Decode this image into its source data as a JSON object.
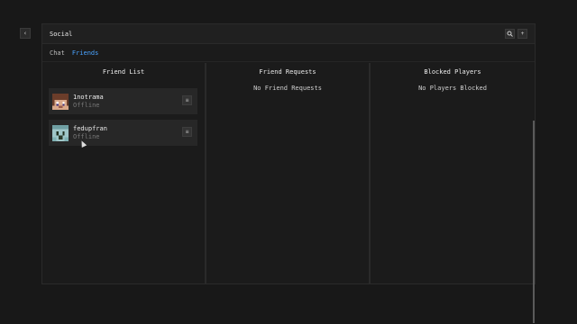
{
  "window": {
    "title": "Social"
  },
  "tabs": [
    {
      "label": "Chat",
      "active": false
    },
    {
      "label": "Friends",
      "active": true
    }
  ],
  "columns": {
    "friend_list": {
      "title": "Friend List"
    },
    "friend_requests": {
      "title": "Friend Requests",
      "empty": "No Friend Requests"
    },
    "blocked_players": {
      "title": "Blocked Players",
      "empty": "No Players Blocked"
    }
  },
  "friends": [
    {
      "name": "1notrama",
      "status": "Offline"
    },
    {
      "name": "fedupfran",
      "status": "Offline"
    }
  ],
  "icons": {
    "back": "chevron-left-icon",
    "search": "search-icon",
    "add": "plus-icon",
    "menu": "menu-icon"
  },
  "colors": {
    "accent": "#4aa3ff"
  }
}
